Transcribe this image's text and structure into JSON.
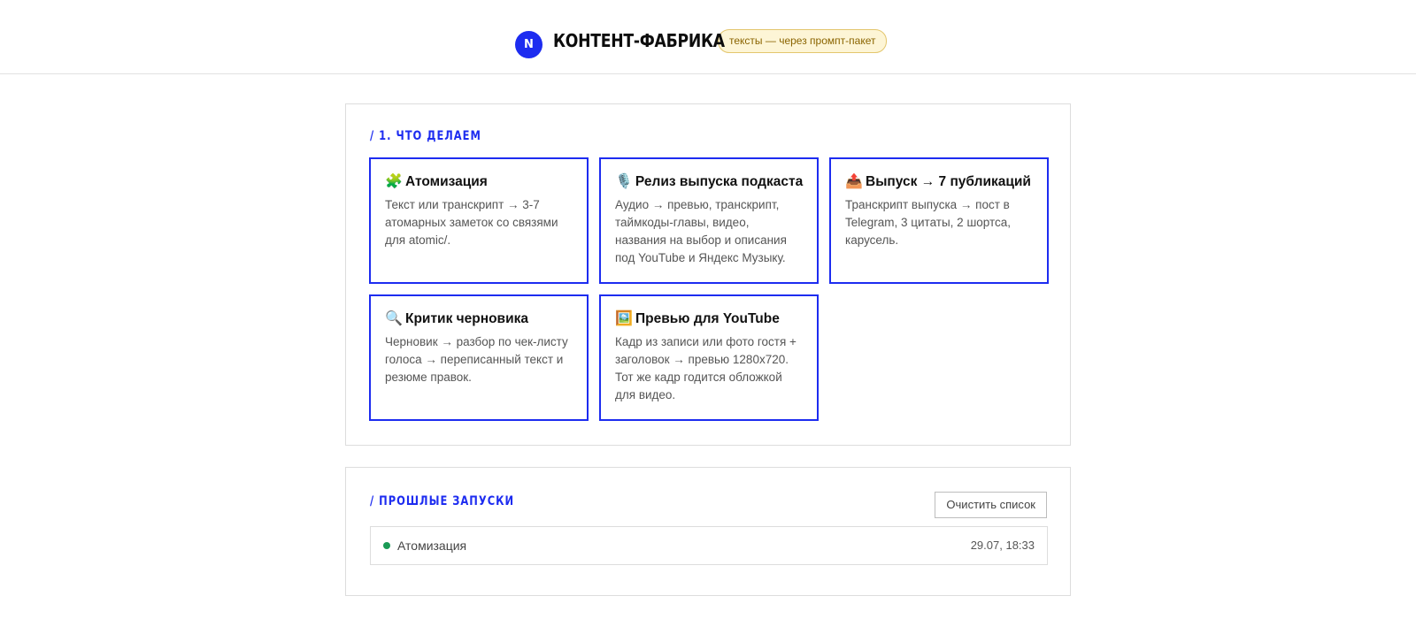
{
  "header": {
    "logo_letter": "N",
    "title": "КОНТЕНТ-ФАБРИКА",
    "badge": "тексты — через промпт-пакет"
  },
  "section1": {
    "title": "/ 1. ЧТО ДЕЛАЕМ",
    "cards": [
      {
        "icon": "🧩",
        "icon_name": "puzzle-icon",
        "title": "Атомизация",
        "desc": "Текст или транскрипт → 3-7 атомарных заметок со связями для atomic/."
      },
      {
        "icon": "🎙️",
        "icon_name": "microphone-icon",
        "title": "Релиз выпуска подкаста",
        "desc": "Аудио → превью, транскрипт, таймкоды-главы, видео, названия на выбор и описания под YouTube и Яндекс Музыку."
      },
      {
        "icon": "📤",
        "icon_name": "outbox-tray-icon",
        "title": "Выпуск → 7 публикаций",
        "desc": "Транскрипт выпуска → пост в Telegram, 3 цитаты, 2 шортса, карусель."
      },
      {
        "icon": "🔍",
        "icon_name": "magnifier-icon",
        "title": "Критик черновика",
        "desc": "Черновик → разбор по чек-листу голоса → переписанный текст и резюме правок."
      },
      {
        "icon": "🖼️",
        "icon_name": "framed-picture-icon",
        "title": "Превью для YouTube",
        "desc": "Кадр из записи или фото гостя + заголовок → превью 1280x720. Тот же кадр годится обложкой для видео."
      }
    ]
  },
  "section2": {
    "title": "/ ПРОШЛЫЕ ЗАПУСКИ",
    "clear_label": "Очистить список",
    "runs": [
      {
        "name": "Атомизация",
        "time": "29.07, 18:33",
        "status_color": "#1a9a55"
      }
    ]
  },
  "colors": {
    "accent": "#1d2cf0",
    "badge_bg": "#fdf5d6",
    "badge_text": "#8a6400",
    "success": "#1a9a55"
  }
}
